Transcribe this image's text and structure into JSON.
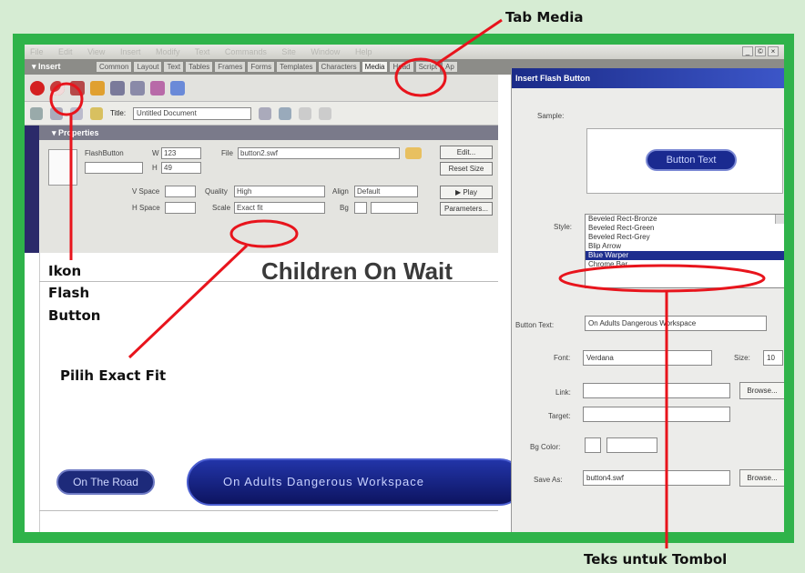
{
  "annotations": {
    "tab_media": "Tab Media",
    "flash_icon_line1": "Ikon",
    "flash_icon_line2": "Flash",
    "flash_icon_line3": "Button",
    "exact_fit": "Pilih Exact Fit",
    "button_text_caption": "Teks untuk Tombol",
    "accent_color": "#e8141c",
    "frame_color": "#2fb34a"
  },
  "app": {
    "menus": [
      "File",
      "Edit",
      "View",
      "Insert",
      "Modify",
      "Text",
      "Commands",
      "Site",
      "Window",
      "Help"
    ],
    "window_controls": [
      "_",
      "©",
      "×"
    ]
  },
  "insert_bar": {
    "label": "▾ Insert",
    "tabs": [
      "Common",
      "Layout",
      "Text",
      "Tables",
      "Frames",
      "Forms",
      "Templates",
      "Characters",
      "Media",
      "Head",
      "Script",
      "Ap"
    ]
  },
  "document_toolbar": {
    "title_label": "Title:",
    "title_value": "Untitled Document"
  },
  "properties": {
    "header": "▾ Properties",
    "type_label": "FlashButton",
    "w_label": "W",
    "w_value": "123",
    "h_label": "H",
    "h_value": "49",
    "file_label": "File",
    "file_value": "button2.swf",
    "edit_button": "Edit...",
    "reset_size_button": "Reset Size",
    "vspace_label": "V Space",
    "hspace_label": "H Space",
    "quality_label": "Quality",
    "quality_value": "High",
    "scale_label": "Scale",
    "scale_value": "Exact fit",
    "align_label": "Align",
    "align_value": "Default",
    "bg_label": "Bg",
    "play_button": "▶ Play",
    "parameters_button": "Parameters..."
  },
  "page": {
    "heading": "Children On Wait",
    "road_button": "On The Road",
    "adults_button": "On Adults Dangerous Workspace"
  },
  "dialog": {
    "title": "Insert Flash Button",
    "sample_label": "Sample:",
    "sample_button": "Button Text",
    "style_label": "Style:",
    "styles": [
      "Beveled Rect-Bronze",
      "Beveled Rect-Green",
      "Beveled Rect-Grey",
      "Blip Arrow",
      "Blue Warper",
      "Chrome Bar"
    ],
    "selected_style": "Blue Warper",
    "button_text_label": "Button Text:",
    "button_text_value": "On Adults Dangerous Workspace",
    "font_label": "Font:",
    "font_value": "Verdana",
    "size_label": "Size:",
    "size_value": "10",
    "link_label": "Link:",
    "link_value": "",
    "target_label": "Target:",
    "target_value": "",
    "bgcolor_label": "Bg Color:",
    "bgcolor_value": "",
    "saveas_label": "Save As:",
    "saveas_value": "button4.swf",
    "browse_button": "Browse..."
  }
}
